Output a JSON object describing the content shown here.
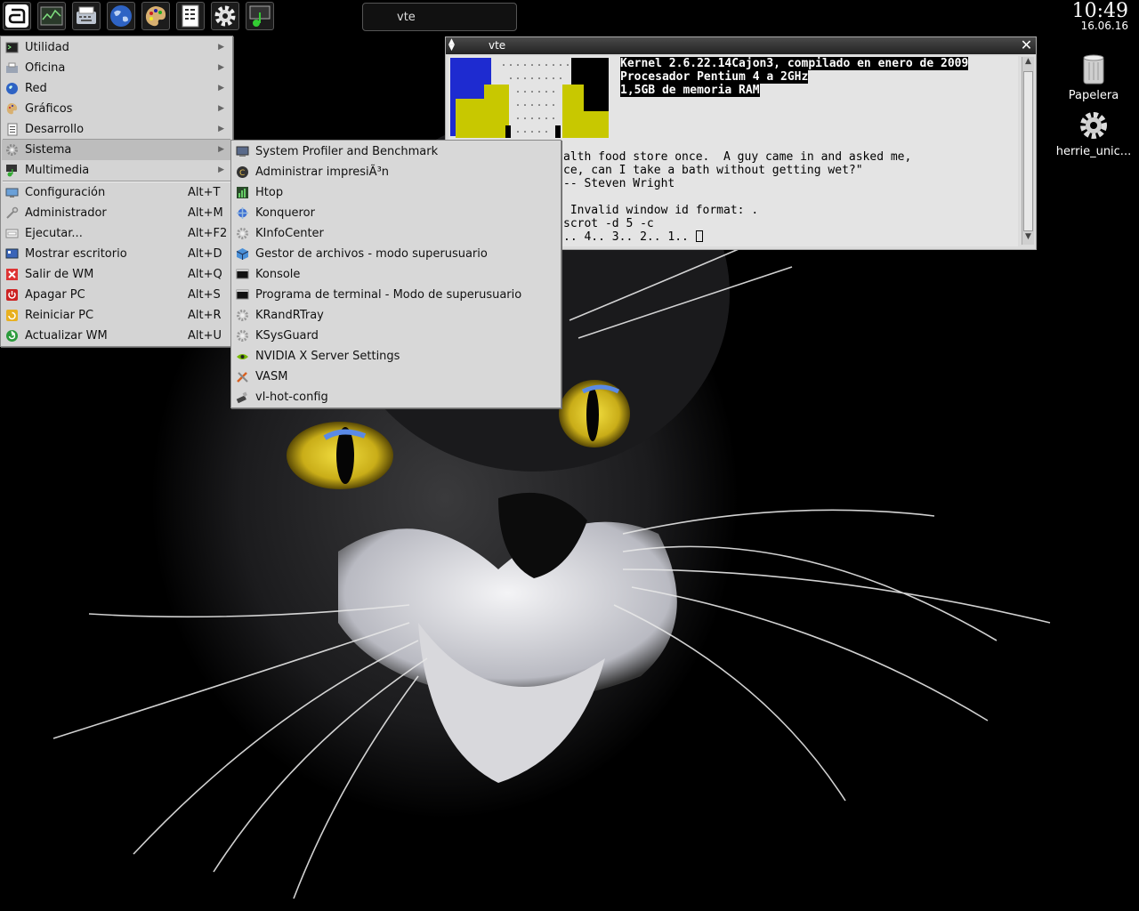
{
  "panel": {
    "task_button": "vte",
    "clock_time": "10:49",
    "clock_date": "16.06.16"
  },
  "desktop_icons": [
    {
      "label": "Papelera"
    },
    {
      "label": "herrie_unic..."
    }
  ],
  "terminal": {
    "title": "vte",
    "lines": [
      "Kernel 2.6.22.14Cajon3, compilado en enero de 2009",
      "Procesador Pentium 4 a 2GHz",
      "1,5GB de memoria RAM",
      "alth food store once.  A guy came in and asked me,",
      "ce, can I take a bath without getting wet?\"",
      "-- Steven Wright",
      " Invalid window id format: .",
      "scrot -d 5 -c",
      ".. 4.. 3.. 2.. 1.. "
    ]
  },
  "main_menu": {
    "items": [
      {
        "label": "Utilidad",
        "shortcut": "",
        "submenu": true,
        "icon": "terminal-icon"
      },
      {
        "label": "Oficina",
        "shortcut": "",
        "submenu": true,
        "icon": "typewriter-icon"
      },
      {
        "label": "Red",
        "shortcut": "",
        "submenu": true,
        "icon": "globe-icon"
      },
      {
        "label": "Gráficos",
        "shortcut": "",
        "submenu": true,
        "icon": "palette-icon"
      },
      {
        "label": "Desarrollo",
        "shortcut": "",
        "submenu": true,
        "icon": "document-icon"
      },
      {
        "label": "Sistema",
        "shortcut": "",
        "submenu": true,
        "icon": "gear-icon"
      },
      {
        "label": "Multimedia",
        "shortcut": "",
        "submenu": true,
        "icon": "media-icon"
      },
      {
        "label": "Configuración",
        "shortcut": "Alt+T",
        "submenu": false,
        "icon": "monitor-icon"
      },
      {
        "label": "Administrador",
        "shortcut": "Alt+M",
        "submenu": false,
        "icon": "wrench-icon"
      },
      {
        "label": "Ejecutar...",
        "shortcut": "Alt+F2",
        "submenu": false,
        "icon": "run-icon"
      },
      {
        "label": "Mostrar escritorio",
        "shortcut": "Alt+D",
        "submenu": false,
        "icon": "desktop-icon"
      },
      {
        "label": "Salir de WM",
        "shortcut": "Alt+Q",
        "submenu": false,
        "icon": "exit-icon"
      },
      {
        "label": "Apagar PC",
        "shortcut": "Alt+S",
        "submenu": false,
        "icon": "power-icon"
      },
      {
        "label": "Reiniciar PC",
        "shortcut": "Alt+R",
        "submenu": false,
        "icon": "restart-icon"
      },
      {
        "label": "Actualizar WM",
        "shortcut": "Alt+U",
        "submenu": false,
        "icon": "refresh-icon"
      }
    ]
  },
  "sub_menu": {
    "items": [
      {
        "label": "System Profiler and Benchmark",
        "icon": "profiler-icon"
      },
      {
        "label": "Administrar impresiÃ³n",
        "icon": "printer-icon"
      },
      {
        "label": "Htop",
        "icon": "htop-icon"
      },
      {
        "label": "Konqueror",
        "icon": "konqueror-icon"
      },
      {
        "label": "KInfoCenter",
        "icon": "gear-icon"
      },
      {
        "label": "Gestor de archivos - modo superusuario",
        "icon": "cube-icon"
      },
      {
        "label": "Konsole",
        "icon": "console-icon"
      },
      {
        "label": "Programa de terminal - Modo de superusuario",
        "icon": "console-icon"
      },
      {
        "label": "KRandRTray",
        "icon": "gear-icon"
      },
      {
        "label": "KSysGuard",
        "icon": "gear-icon"
      },
      {
        "label": "NVIDIA X Server Settings",
        "icon": "nvidia-icon"
      },
      {
        "label": "VASM",
        "icon": "tools-icon"
      },
      {
        "label": "vl-hot-config",
        "icon": "usb-icon"
      }
    ]
  },
  "colors": {
    "menu_bg": "#d4d4d4",
    "menu_active": "#bdbdbd",
    "eye_yellow": "#d6c21e",
    "terminal_bg": "#e4e4e4"
  }
}
